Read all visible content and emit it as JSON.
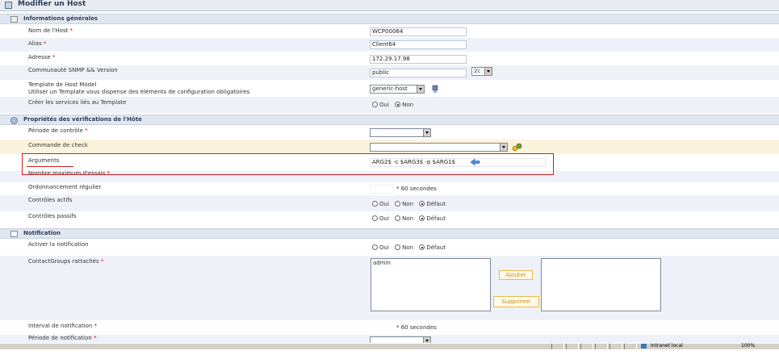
{
  "page_title": "Modifier un Host",
  "sections": {
    "general": "Informations générales",
    "checks": "Propriétés des vérifications de l'Hôte",
    "notification": "Notification"
  },
  "fields": {
    "host_name": {
      "label": "Nom de l'Host",
      "value": "WCP00064"
    },
    "alias": {
      "label": "Alias",
      "value": "Client64"
    },
    "address": {
      "label": "Adresse",
      "value": "172.29.17.98"
    },
    "snmp": {
      "label": "Communauté SNMP && Version",
      "value": "public",
      "version": "2c"
    },
    "template": {
      "label": "Template de Host Model",
      "sublabel": "Utiliser un Template vous dispense des éléments de configuration obligatoires",
      "value": "generic-host"
    },
    "create_services": {
      "label": "Créer les services liés au Template",
      "options": [
        "Oui",
        "Non"
      ]
    },
    "check_period": {
      "label": "Période de contrôle",
      "value": ""
    },
    "check_command": {
      "label": "Commande de check",
      "value": ""
    },
    "arguments": {
      "label": "Arguments",
      "value": "ARG2$ -c $ARG3$ -p $ARG1$"
    },
    "max_attempts": {
      "label": "Nombre maximum d'essais",
      "value": ""
    },
    "normal_interval": {
      "label": "Ordonnancement régulier",
      "suffix": "* 60 secondes"
    },
    "active_checks": {
      "label": "Contrôles actifs",
      "options": [
        "Oui",
        "Non",
        "Défaut"
      ]
    },
    "passive_checks": {
      "label": "Contrôles passifs",
      "options": [
        "Oui",
        "Non",
        "Défaut"
      ]
    },
    "notif_enabled": {
      "label": "Activer la notification",
      "options": [
        "Oui",
        "Non",
        "Défaut"
      ]
    },
    "contact_groups": {
      "label": "ContactGroups rattachés",
      "selected": [
        "admin"
      ],
      "add_label": "Ajouter",
      "remove_label": "Supprimer"
    },
    "notif_interval": {
      "label": "Interval de notification",
      "suffix": "* 60 secondes"
    },
    "notif_period": {
      "label": "Période de notification"
    }
  },
  "statusbar": {
    "zone": "Intranet local",
    "zoom": "100%"
  },
  "colors": {
    "required": "#e00000",
    "highlight_box": "#d02020",
    "section_bg": "#e1e7f0"
  }
}
